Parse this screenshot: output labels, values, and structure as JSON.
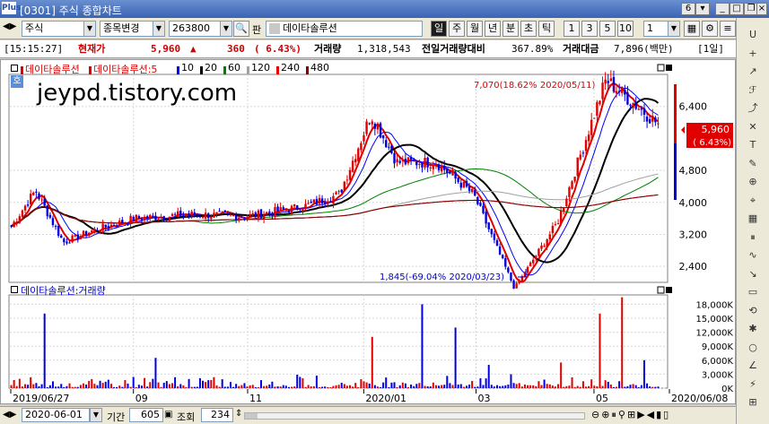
{
  "window": {
    "title": "[0301] 주식 종합차트",
    "logo": "Plus",
    "tab_number": "6"
  },
  "toolbar": {
    "market": "주식",
    "change_label": "종목변경",
    "code": "263800",
    "pan_label": "판",
    "stock_name": "데이타솔루션",
    "periods": [
      "일",
      "주",
      "월",
      "년",
      "분",
      "초",
      "틱"
    ],
    "active_period": "일",
    "intervals": [
      "1",
      "3",
      "5",
      "10"
    ],
    "interval_value": "1"
  },
  "quote": {
    "time": "[15:15:27]",
    "current_label": "현재가",
    "price": "5,960",
    "arrow": "▲",
    "change": "360",
    "change_pct": "( 6.43%)",
    "volume_label": "거래량",
    "volume": "1,318,543",
    "prev_ratio_label": "전일거래량대비",
    "prev_ratio": "367.89%",
    "amount_label": "거래대금",
    "amount": "7,896(백만)",
    "period_badge": "[1일]"
  },
  "price_pane": {
    "badge": "호",
    "watermark": "jeypd.tistory.com",
    "legend": [
      {
        "label": "데이타솔루션",
        "color": "#e00000"
      },
      {
        "label": "데이타솔루션:5",
        "color": "#e00000"
      },
      {
        "label": "10",
        "color": "#0000ff"
      },
      {
        "label": "20",
        "color": "#000000"
      },
      {
        "label": "60",
        "color": "#008000"
      },
      {
        "label": "120",
        "color": "#a0a0a0"
      },
      {
        "label": "240",
        "color": "#e00000"
      },
      {
        "label": "480",
        "color": "#800000"
      }
    ],
    "y_ticks": [
      "6,400",
      "4,800",
      "4,000",
      "3,200",
      "2,400"
    ],
    "high_annotation": "7,070(18.62% 2020/05/11)",
    "low_annotation": "1,845(-69.04% 2020/03/23)",
    "current_price_tag": "5,960",
    "current_pct_tag": "( 6.43%)"
  },
  "volume_pane": {
    "legend": "데이타솔루션:거래량",
    "y_ticks": [
      "18,000K",
      "15,000K",
      "12,000K",
      "9,000K",
      "6,000K",
      "3,000K",
      "0K"
    ]
  },
  "x_axis": [
    "2019/06/27",
    "09",
    "11",
    "2020/01",
    "03",
    "05",
    "2020/06/08"
  ],
  "bottom": {
    "date": "2020-06-01",
    "period_label": "기간",
    "period_value": "605",
    "lookup_label": "조회",
    "lookup_value": "234"
  },
  "sidebar_tools": [
    "line-tool",
    "cross-tool",
    "trend-tool",
    "fib-tool",
    "auto-tool",
    "delete-tool",
    "text-tool",
    "draw-tool",
    "measure-tool",
    "zoom-tool",
    "grid-tool",
    "period-tool",
    "wave-tool",
    "arrow-tool",
    "box-tool",
    "rev-tool",
    "mark-tool",
    "circle-tool",
    "angle-tool",
    "speed-tool",
    "gann-tool"
  ],
  "chart_data": {
    "type": "line",
    "title": "데이타솔루션",
    "x_range": [
      "2019/06/27",
      "2020/06/08"
    ],
    "ylim_price": [
      2000,
      7200
    ],
    "price_points": [
      {
        "x": "2019/06/27",
        "y": 3400
      },
      {
        "x": "2019/07/10",
        "y": 4300
      },
      {
        "x": "2019/07/25",
        "y": 3000
      },
      {
        "x": "2019/08/10",
        "y": 3300
      },
      {
        "x": "2019/09/01",
        "y": 3600
      },
      {
        "x": "2019/10/01",
        "y": 3700
      },
      {
        "x": "2019/11/01",
        "y": 3650
      },
      {
        "x": "2019/12/01",
        "y": 3900
      },
      {
        "x": "2019/12/20",
        "y": 4200
      },
      {
        "x": "2020/01/06",
        "y": 6200
      },
      {
        "x": "2020/01/20",
        "y": 5000
      },
      {
        "x": "2020/02/10",
        "y": 5000
      },
      {
        "x": "2020/03/01",
        "y": 4200
      },
      {
        "x": "2020/03/23",
        "y": 1845
      },
      {
        "x": "2020/04/15",
        "y": 3500
      },
      {
        "x": "2020/05/11",
        "y": 7070
      },
      {
        "x": "2020/06/08",
        "y": 5960
      }
    ],
    "volume_max": "18,000K"
  }
}
